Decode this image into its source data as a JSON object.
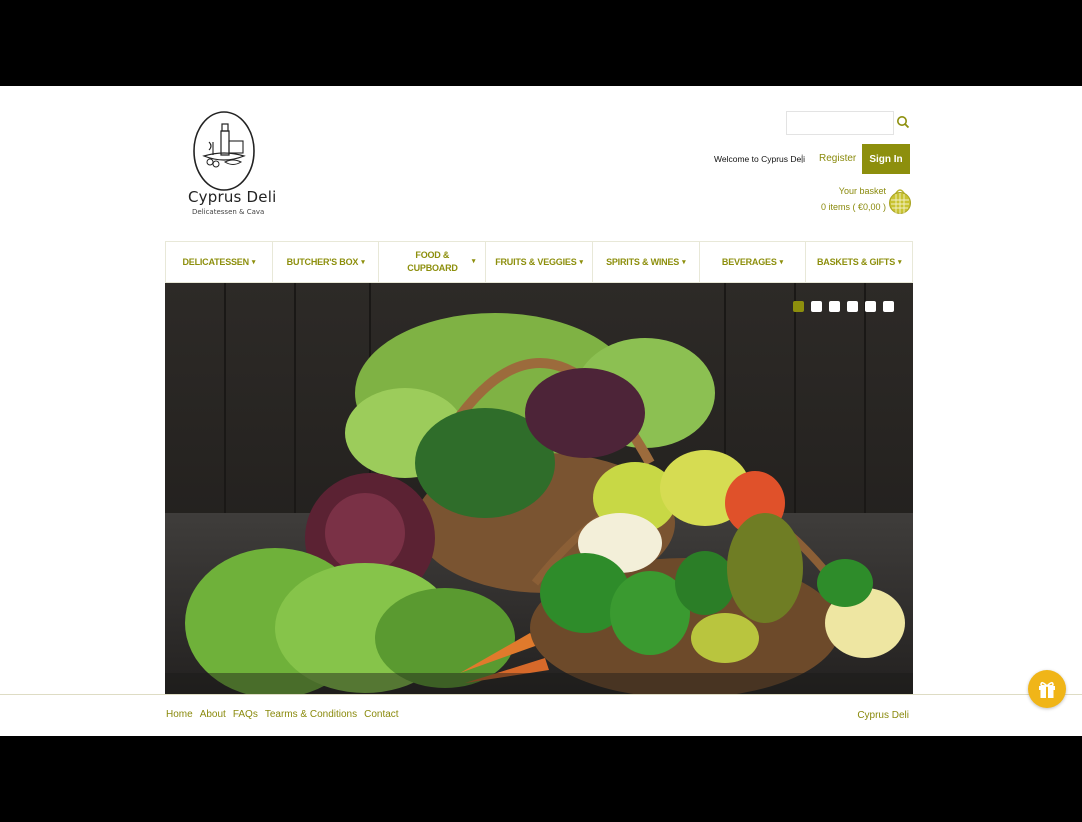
{
  "brand": {
    "name": "Cyprus Deli",
    "tagline": "Delicatessen & Cava"
  },
  "header": {
    "search_placeholder": "",
    "welcome": "Welcome to Cyprus Deli",
    "separator": "|",
    "register_label": "Register",
    "signin_label": "Sign In",
    "basket_label": "Your basket",
    "basket_items": "0 items ( €0,00 )"
  },
  "nav": {
    "items": [
      {
        "label": "DELICATESSEN"
      },
      {
        "label": "BUTCHER'S BOX"
      },
      {
        "label": "FOOD & CUPBOARD"
      },
      {
        "label": "FRUITS & VEGGIES"
      },
      {
        "label": "SPIRITS & WINES"
      },
      {
        "label": "BEVERAGES"
      },
      {
        "label": "BASKETS & GIFTS"
      }
    ],
    "caret": "▾"
  },
  "slider": {
    "slide_count": 6,
    "active_index": 0
  },
  "footer": {
    "links": [
      "Home",
      "About",
      "FAQs",
      "Tearms & Conditions",
      "Contact"
    ],
    "brand": "Cyprus Deli"
  },
  "colors": {
    "accent": "#8d8f0d",
    "gift": "#f0b518",
    "frame": "#000000"
  },
  "icons": {
    "search": "search-icon",
    "basket": "basket-icon",
    "gift": "gift-icon"
  }
}
